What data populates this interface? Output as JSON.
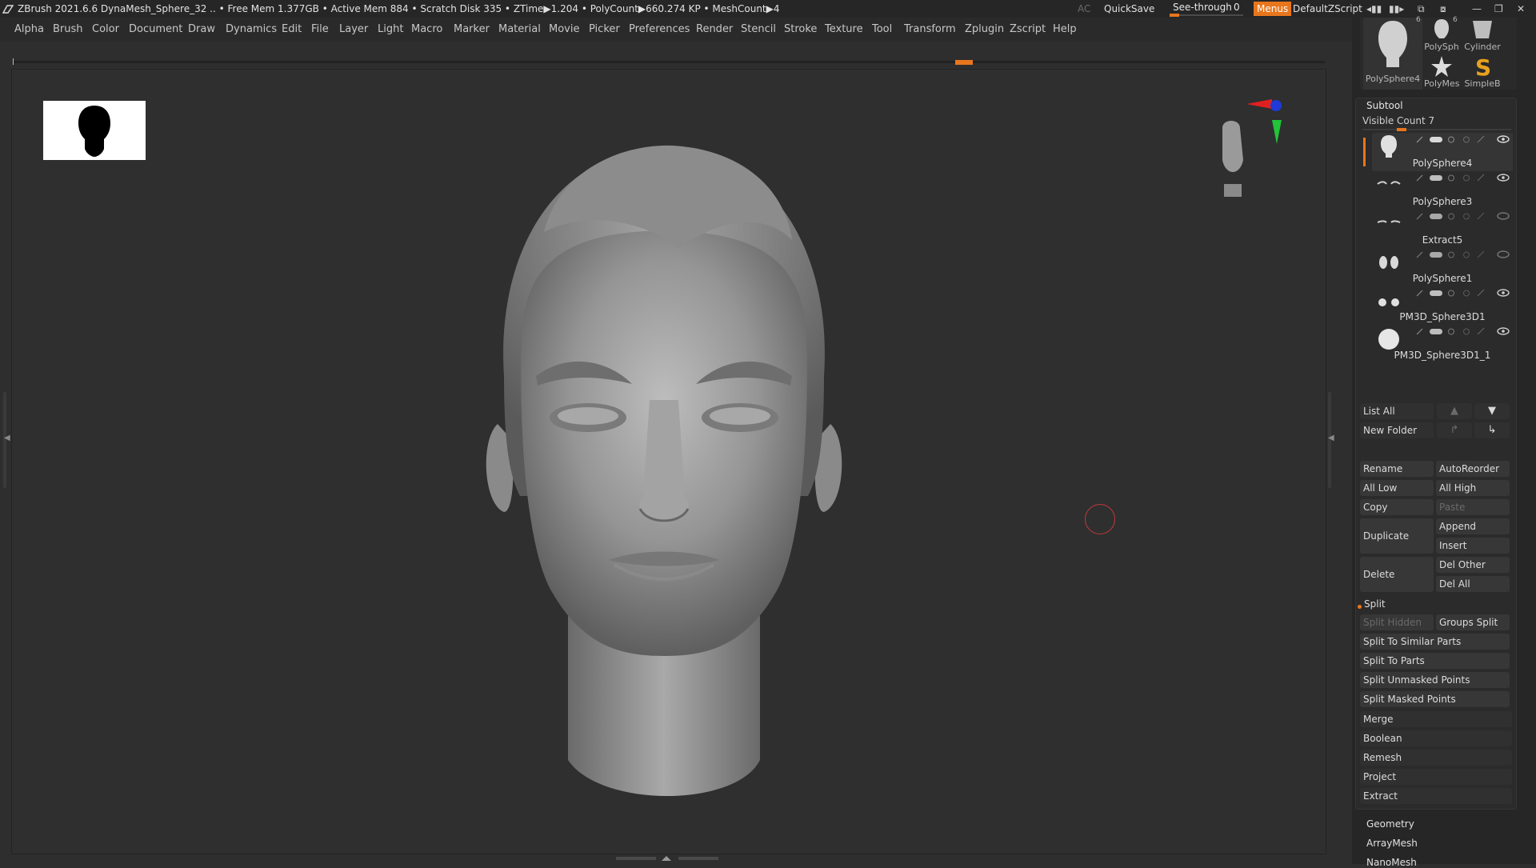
{
  "titlebar": {
    "title": "ZBrush 2021.6.6   DynaMesh_Sphere_32   .. • Free Mem 1.377GB • Active Mem 884 • Scratch Disk 335 •  ZTime▶1.204 • PolyCount▶660.274 KP  • MeshCount▶4",
    "ac": "AC",
    "quicksave": "QuickSave",
    "seethrough_label": "See-through",
    "seethrough_value": "0",
    "seethrough_level": 0,
    "menus": "Menus",
    "default_zscript": "DefaultZScript",
    "accent": "#e8761d"
  },
  "menubar": {
    "items": [
      "Alpha",
      "Brush",
      "Color",
      "Document",
      "Draw",
      "Dynamics",
      "Edit",
      "File",
      "Layer",
      "Light",
      "Macro",
      "Marker",
      "Material",
      "Movie",
      "Picker",
      "Preferences",
      "Render",
      "Stencil",
      "Stroke",
      "Texture",
      "Tool",
      "Transform",
      "Zplugin",
      "Zscript",
      "Help"
    ]
  },
  "tool_thumbs": [
    {
      "label": "PolySphere4",
      "badge": "6"
    },
    {
      "label": "PolySph",
      "badge": "6"
    },
    {
      "label": "Cylinder",
      "badge": ""
    },
    {
      "label": "PolyMes",
      "badge": ""
    },
    {
      "label": "SimpleB",
      "badge": ""
    }
  ],
  "subtool": {
    "title": "Subtool",
    "visible_count": "Visible Count 7",
    "items": [
      {
        "name": "PolySphere4",
        "icon": "head-icon",
        "active": true
      },
      {
        "name": "PolySphere3",
        "icon": "eyebrows-icon",
        "active": false
      },
      {
        "name": "Extract5",
        "icon": "eyebrows-icon",
        "active": false
      },
      {
        "name": "PolySphere1",
        "icon": "ears-icon",
        "active": false
      },
      {
        "name": "PM3D_Sphere3D1",
        "icon": "eyes-icon",
        "active": false
      },
      {
        "name": "PM3D_Sphere3D1_1",
        "icon": "sphere-icon",
        "active": false
      }
    ],
    "list_all": "List All",
    "new_folder": "New Folder",
    "rename": "Rename",
    "autoreorder": "AutoReorder",
    "all_low": "All Low",
    "all_high": "All High",
    "copy": "Copy",
    "paste": "Paste",
    "duplicate": "Duplicate",
    "append": "Append",
    "insert": "Insert",
    "delete": "Delete",
    "del_other": "Del Other",
    "del_all": "Del All"
  },
  "split": {
    "title": "Split",
    "split_hidden": "Split Hidden",
    "groups_split": "Groups Split",
    "similar_parts": "Split To Similar Parts",
    "to_parts": "Split To Parts",
    "unmasked_points": "Split Unmasked Points",
    "masked_points": "Split Masked Points"
  },
  "sections": [
    "Merge",
    "Boolean",
    "Remesh",
    "Project",
    "Extract"
  ],
  "bottom_sections": [
    "Geometry",
    "ArrayMesh",
    "NanoMesh"
  ]
}
